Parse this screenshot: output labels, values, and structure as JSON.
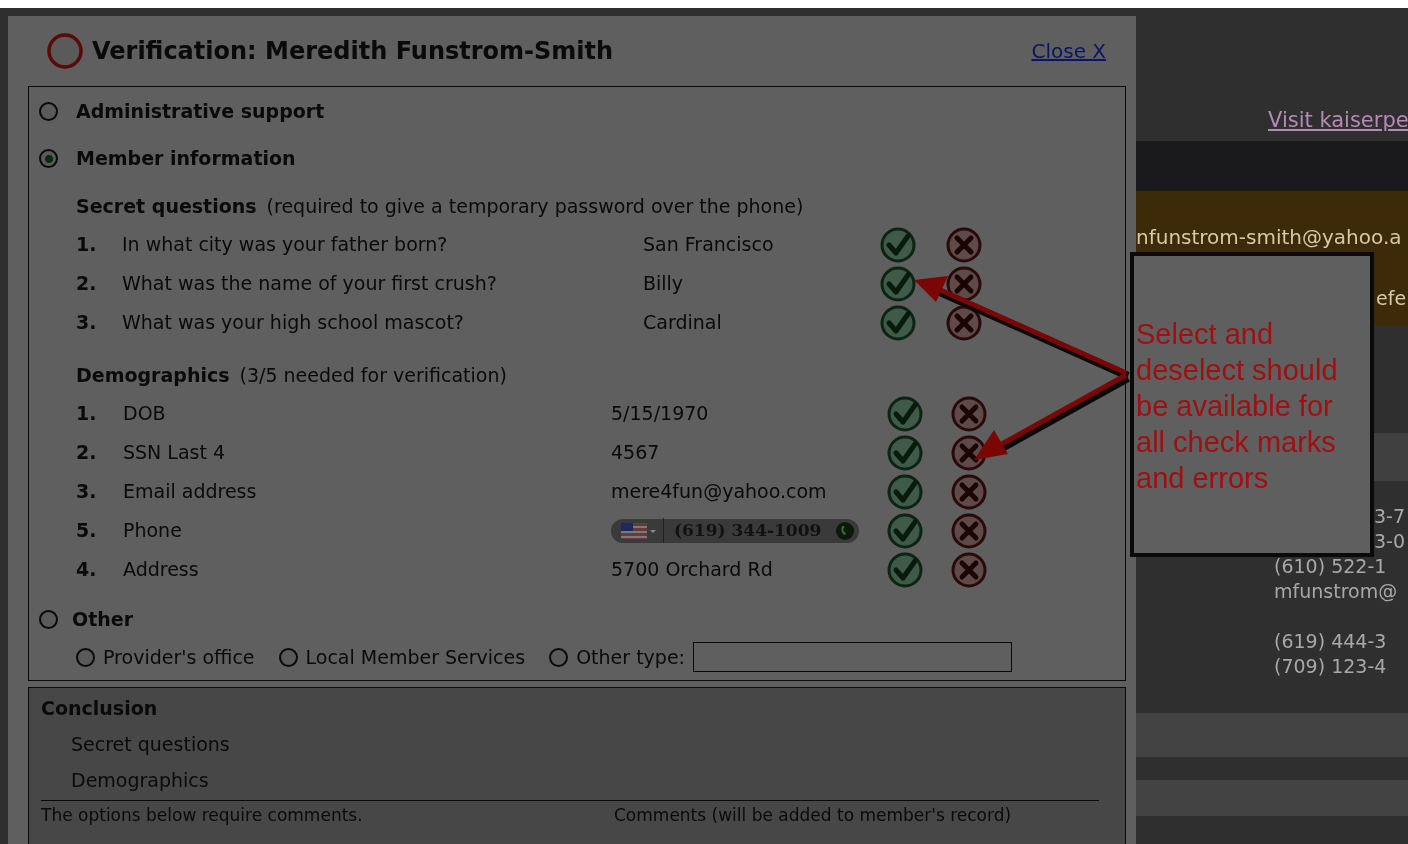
{
  "dialog": {
    "title": "Verification: Meredith Funstrom-Smith",
    "close_link": "Close X",
    "options": [
      {
        "label": "Administrative support",
        "selected": false
      },
      {
        "label": "Member information",
        "selected": true
      },
      {
        "label": "Other",
        "selected": false
      }
    ],
    "secret_questions": {
      "heading": "Secret questions",
      "note": "(required to give a temporary password over the phone)",
      "rows": [
        {
          "number": "1.",
          "question": "In what city was your father born?",
          "answer": "San Francisco"
        },
        {
          "number": "2.",
          "question": "What was the name of your first crush?",
          "answer": "Billy"
        },
        {
          "number": "3.",
          "question": "What was your high school mascot?",
          "answer": "Cardinal"
        }
      ]
    },
    "demographics": {
      "heading": "Demographics",
      "note": "(3/5 needed for verification)",
      "rows": [
        {
          "number": "1.",
          "label": "DOB",
          "kind": "text",
          "value": "5/15/1970"
        },
        {
          "number": "2.",
          "label": "SSN Last 4",
          "kind": "text",
          "value": "4567"
        },
        {
          "number": "3.",
          "label": "Email address",
          "kind": "text",
          "value": "mere4fun@yahoo.com"
        },
        {
          "number": "5.",
          "label": "Phone",
          "kind": "phone",
          "value": "(619) 344-1009"
        },
        {
          "number": "4.",
          "label": "Address",
          "kind": "text",
          "value": "5700 Orchard Rd"
        }
      ]
    },
    "other_types": [
      {
        "label": "Provider's office",
        "selected": false
      },
      {
        "label": "Local Member Services",
        "selected": false
      },
      {
        "label": "Other type:",
        "selected": false
      }
    ],
    "conclusion": {
      "heading": "Conclusion",
      "items": [
        "Secret questions",
        "Demographics"
      ],
      "note_left": "The options below require comments.",
      "note_right": "Comments (will be added to member's record)"
    }
  },
  "annotation": {
    "text": "Select and deselect should be available for all check marks and errors"
  },
  "background": {
    "link": "Visit kaiserpe",
    "email": "nfunstrom-smith@yahoo.a",
    "fragment": "efe",
    "codes": [
      "3-7",
      "3-0"
    ],
    "contacts": [
      "(610) 522-1",
      "mfunstrom@"
    ],
    "phones": [
      "(619) 444-3",
      "(709) 123-4"
    ]
  }
}
